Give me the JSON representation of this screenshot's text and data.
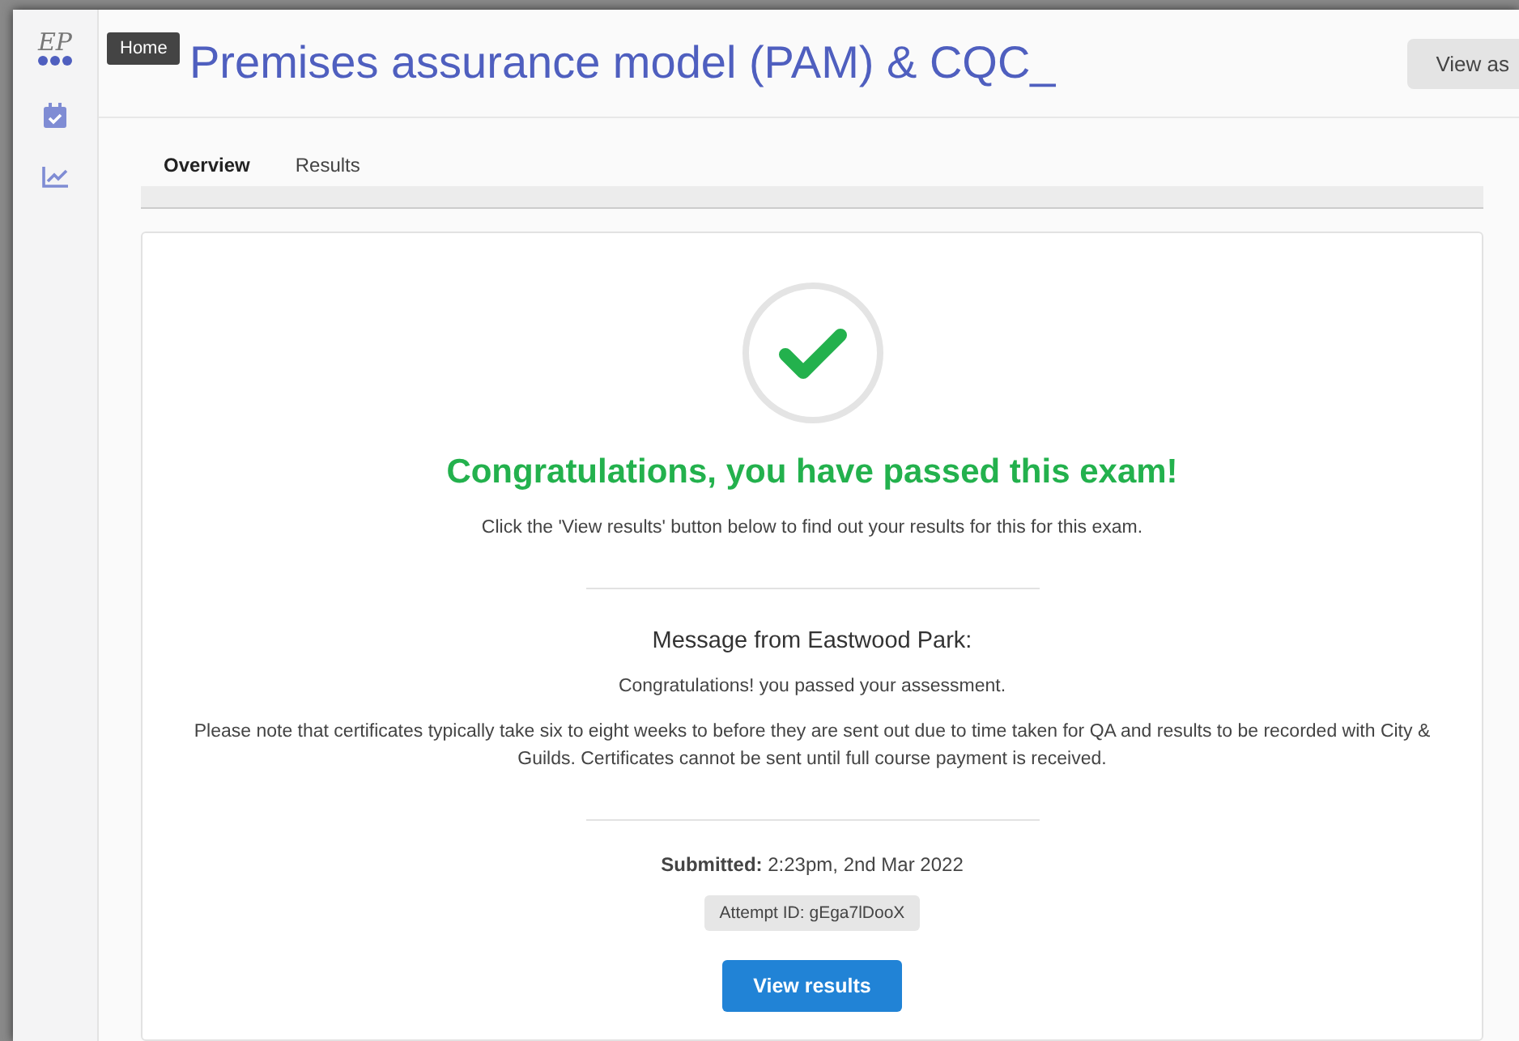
{
  "sidebar": {
    "tooltip": "Home",
    "items": [
      {
        "kind": "logo",
        "text": "EP"
      },
      {
        "kind": "calendar"
      },
      {
        "kind": "chart"
      }
    ]
  },
  "header": {
    "title": "Premises assurance model (PAM) & CQC_",
    "button": "View as"
  },
  "tabs": [
    {
      "label": "Overview",
      "selected": true
    },
    {
      "label": "Results",
      "selected": false
    }
  ],
  "result": {
    "passed": true,
    "heading": "Congratulations, you have passed this exam!",
    "instruction": "Click the 'View results' button below to find out your results for this for this exam.",
    "message_title": "Message from Eastwood Park:",
    "message_lines": [
      "Congratulations! you passed your assessment.",
      "Please note that certificates typically take six to eight weeks to before they are sent out due to time taken for QA and results to be recorded with City & Guilds.  Certificates cannot be sent until full course payment is received."
    ],
    "submitted_label": "Submitted:",
    "submitted_value": "2:23pm, 2nd Mar 2022",
    "attempt": "Attempt ID: gEga7lDooX",
    "button": "View results"
  }
}
